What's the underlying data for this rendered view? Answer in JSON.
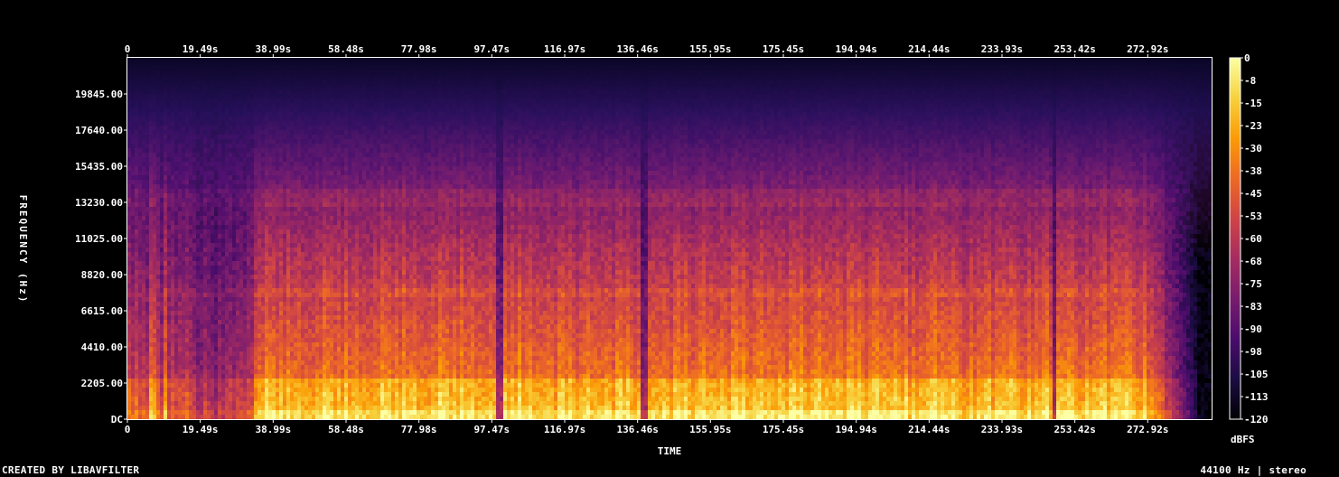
{
  "chart_data": {
    "type": "heatmap",
    "x_ticks": [
      "0",
      "19.49s",
      "38.99s",
      "58.48s",
      "77.98s",
      "97.47s",
      "116.97s",
      "136.46s",
      "155.95s",
      "175.45s",
      "194.94s",
      "214.44s",
      "233.93s",
      "253.42s",
      "272.92s"
    ],
    "x_tick_values": [
      0,
      19.49,
      38.99,
      58.48,
      77.98,
      97.47,
      116.97,
      136.46,
      155.95,
      175.45,
      194.94,
      214.44,
      233.93,
      253.42,
      272.92
    ],
    "xlim": [
      0,
      290
    ],
    "xlabel": "TIME",
    "y_ticks": [
      "DC",
      "2205.00",
      "4410.00",
      "6615.00",
      "8820.00",
      "11025.00",
      "13230.00",
      "15435.00",
      "17640.00",
      "19845.00"
    ],
    "y_tick_values": [
      0,
      2205,
      4410,
      6615,
      8820,
      11025,
      13230,
      15435,
      17640,
      19845
    ],
    "ylim": [
      0,
      22050
    ],
    "ylabel": "FREQUENCY (Hz)",
    "colorbar": {
      "label": "dBFS",
      "ticks": [
        "0",
        "-8",
        "-15",
        "-23",
        "-30",
        "-38",
        "-45",
        "-53",
        "-60",
        "-68",
        "-75",
        "-83",
        "-90",
        "-98",
        "-105",
        "-113",
        "-120"
      ],
      "range": [
        -120,
        0
      ],
      "colormap": [
        "#000004",
        "#1b0c41",
        "#4a0c6b",
        "#781c6d",
        "#a52c60",
        "#cf4446",
        "#ed6925",
        "#fb9b06",
        "#f7d13d",
        "#fcffa4"
      ]
    },
    "content_end_s": 286
  },
  "footer": {
    "credit": "CREATED BY LIBAVFILTER",
    "info": "44100 Hz | stereo"
  }
}
